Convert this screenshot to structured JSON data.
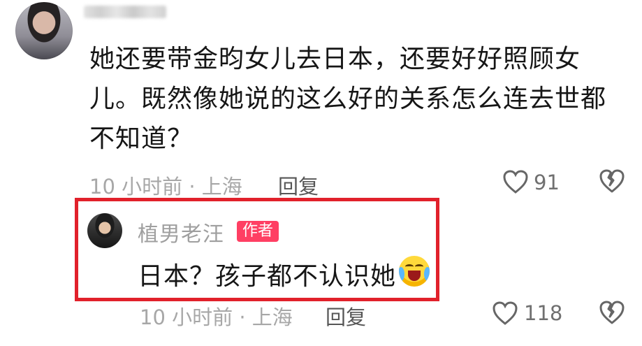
{
  "comment": {
    "username": "",
    "text_lines": [
      "她还要带金昀女儿去日本，还要好好照顾女",
      "儿。既然像她说的这么好的关系怎么连去世都",
      "不知道？"
    ],
    "time_location": "10 小时前 · 上海",
    "reply_label": "回复",
    "likes": "91",
    "icons": {
      "like": "heart-outline-icon",
      "dislike": "broken-heart-icon"
    }
  },
  "reply": {
    "name": "植男老汪",
    "badge": "作者",
    "text": "日本？孩子都不认识她",
    "emoji": "laughing-crying-emoji",
    "time_location": "10 小时前 · 上海",
    "reply_label": "回复",
    "likes": "118",
    "icons": {
      "like": "heart-outline-icon",
      "dislike": "broken-heart-icon"
    }
  },
  "colors": {
    "highlight_border": "#e1212b",
    "author_badge": "#ff3f63"
  }
}
